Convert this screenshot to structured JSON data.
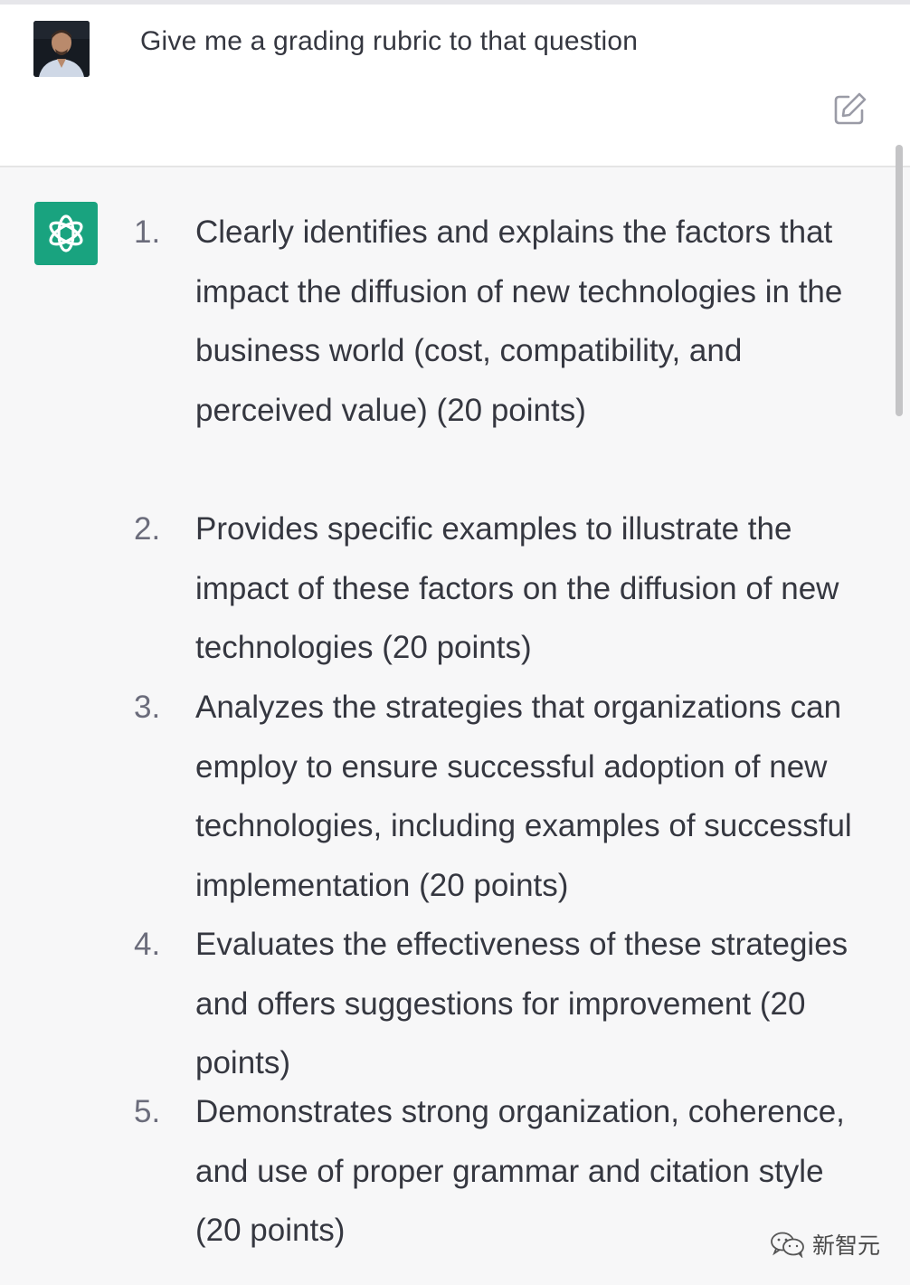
{
  "conversation": {
    "user_message": {
      "text": "Give me a grading rubric to that question",
      "avatar_icon": "user-photo-avatar",
      "edit_icon": "edit-icon"
    },
    "assistant_message": {
      "avatar_icon": "openai-logo-icon",
      "avatar_color": "#19a37f",
      "items": [
        {
          "number": "1.",
          "text": "Clearly identifies and explains the factors that impact the diffusion of new technologies in the business world (cost, compatibility, and perceived value) (20 points)"
        },
        {
          "number": "2.",
          "text": "Provides specific examples to illustrate the impact of these factors on the diffusion of new technologies (20 points)"
        },
        {
          "number": "3.",
          "text": "Analyzes the strategies that organizations can employ to ensure successful adoption of new technologies, including examples of successful implementation (20 points)"
        },
        {
          "number": "4.",
          "text": "Evaluates the effectiveness of these strategies and offers suggestions for improvement (20 points)"
        },
        {
          "number": "5.",
          "text": "Demonstrates strong organization, coherence, and use of proper grammar and citation style (20 points)"
        }
      ]
    }
  },
  "watermark": {
    "text": "新智元",
    "icon": "wechat-logo-icon"
  }
}
